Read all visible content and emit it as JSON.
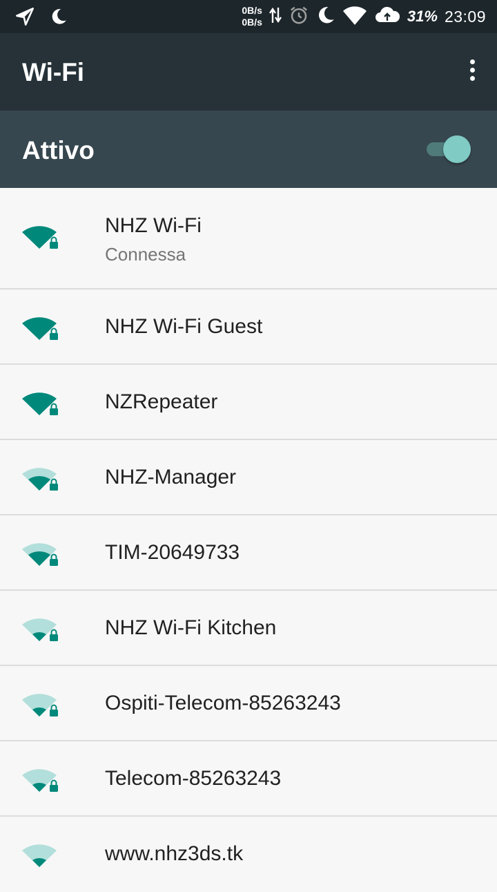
{
  "status_bar": {
    "left_icons": [
      "navigation-icon",
      "moon-icon"
    ],
    "net_up": "0B/s",
    "net_down": "0B/s",
    "right_icons": [
      "data-arrows-icon",
      "alarm-icon",
      "moon-icon",
      "wifi-icon",
      "cloud-icon"
    ],
    "battery_percent": "31%",
    "time": "23:09"
  },
  "toolbar": {
    "title": "Wi-Fi",
    "menu_icon": "more-vert-icon"
  },
  "master_switch": {
    "label": "Attivo",
    "on": true
  },
  "colors": {
    "status_bar_bg": "#1d262b",
    "toolbar_bg": "#263238",
    "switch_bar_bg": "#37474f",
    "accent": "#00897b",
    "toggle_thumb": "#80cbc4",
    "list_bg": "#f7f7f7"
  },
  "networks": [
    {
      "ssid": "NHZ Wi-Fi",
      "status": "Connessa",
      "signal_bars": 4,
      "secured": true
    },
    {
      "ssid": "NHZ Wi-Fi Guest",
      "signal_bars": 4,
      "secured": true
    },
    {
      "ssid": "NZRepeater",
      "signal_bars": 4,
      "secured": true
    },
    {
      "ssid": "NHZ-Manager",
      "signal_bars": 3,
      "secured": true
    },
    {
      "ssid": "TIM-20649733",
      "signal_bars": 3,
      "secured": true
    },
    {
      "ssid": "NHZ Wi-Fi Kitchen",
      "signal_bars": 2,
      "secured": true
    },
    {
      "ssid": "Ospiti-Telecom-85263243",
      "signal_bars": 2,
      "secured": true
    },
    {
      "ssid": "Telecom-85263243",
      "signal_bars": 2,
      "secured": true
    },
    {
      "ssid": "www.nhz3ds.tk",
      "signal_bars": 2,
      "secured": false
    }
  ]
}
